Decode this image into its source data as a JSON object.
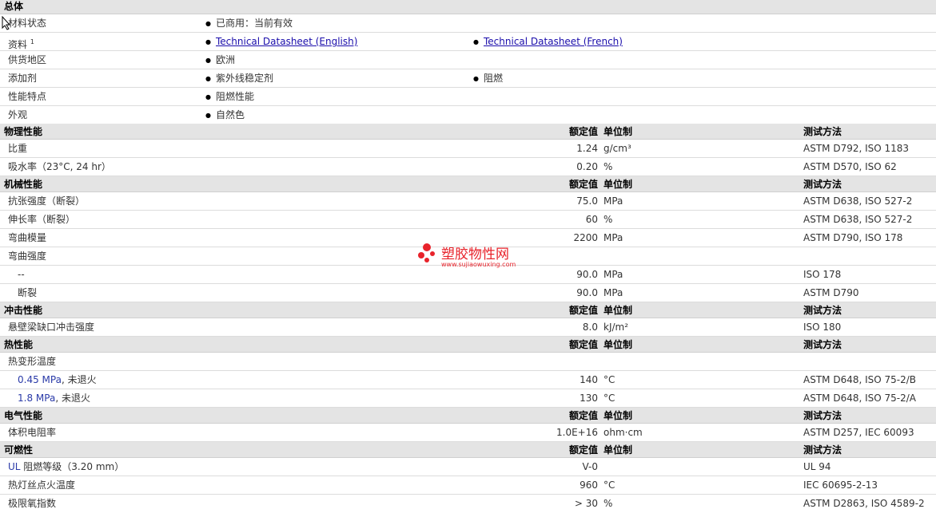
{
  "general": {
    "title": "总体",
    "rows": [
      {
        "label": "材料状态",
        "items": [
          "已商用：当前有效"
        ]
      },
      {
        "label": "资料",
        "sup": "1",
        "items": [
          "Technical Datasheet (English)",
          "Technical Datasheet (French)"
        ]
      },
      {
        "label": "供货地区",
        "items": [
          "欧洲"
        ]
      },
      {
        "label": "添加剂",
        "items": [
          "紫外线稳定剂",
          "阻燃"
        ]
      },
      {
        "label": "性能特点",
        "items": [
          "阻燃性能"
        ]
      },
      {
        "label": "外观",
        "items": [
          "自然色"
        ]
      }
    ]
  },
  "headers": {
    "value": "额定值",
    "unit": "单位制",
    "method": "测试方法"
  },
  "sections": [
    {
      "title": "物理性能",
      "rows": [
        {
          "label": "比重",
          "value": "1.24",
          "unit": "g/cm³",
          "method": "ASTM D792, ISO 1183"
        },
        {
          "label": "吸水率（23°C, 24 hr）",
          "value": "0.20",
          "unit": "%",
          "method": "ASTM D570, ISO 62"
        }
      ]
    },
    {
      "title": "机械性能",
      "rows": [
        {
          "label": "抗张强度（断裂）",
          "value": "75.0",
          "unit": "MPa",
          "method": "ASTM D638, ISO 527-2"
        },
        {
          "label": "伸长率（断裂）",
          "value": "60",
          "unit": "%",
          "method": "ASTM D638, ISO 527-2"
        },
        {
          "label": "弯曲模量",
          "value": "2200",
          "unit": "MPa",
          "method": "ASTM D790, ISO 178"
        },
        {
          "label": "弯曲强度",
          "value": "",
          "unit": "",
          "method": ""
        },
        {
          "label": "--",
          "value": "90.0",
          "unit": "MPa",
          "method": "ISO 178"
        },
        {
          "label": "断裂",
          "value": "90.0",
          "unit": "MPa",
          "method": "ASTM D790"
        }
      ]
    },
    {
      "title": "冲击性能",
      "rows": [
        {
          "label": "悬壁梁缺口冲击强度",
          "value": "8.0",
          "unit": "kJ/m²",
          "method": "ISO 180"
        }
      ]
    },
    {
      "title": "热性能",
      "rows": [
        {
          "label": "热变形温度",
          "value": "",
          "unit": "",
          "method": ""
        },
        {
          "label_blue": "0.45 MPa",
          "label_rest": ", 未退火",
          "value": "140",
          "unit": "°C",
          "method": "ASTM D648, ISO 75-2/B"
        },
        {
          "label_blue": "1.8 MPa",
          "label_rest": ", 未退火",
          "value": "130",
          "unit": "°C",
          "method": "ASTM D648, ISO 75-2/A"
        }
      ]
    },
    {
      "title": "电气性能",
      "rows": [
        {
          "label": "体积电阻率",
          "value": "1.0E+16",
          "unit": "ohm·cm",
          "method": "ASTM D257, IEC 60093"
        }
      ]
    },
    {
      "title": "可燃性",
      "rows": [
        {
          "label_blue": "UL",
          "label_rest": " 阻燃等级（3.20 mm）",
          "value": "V-0",
          "unit": "",
          "method": "UL 94"
        },
        {
          "label": "热灯丝点火温度",
          "value": "960",
          "unit": "°C",
          "method": "IEC 60695-2-13"
        },
        {
          "label": "极限氧指数",
          "value": "> 30",
          "unit": "%",
          "method": "ASTM D2863, ISO 4589-2"
        }
      ]
    }
  ],
  "watermark": {
    "name": "塑胶物性网",
    "url": "www.sujiaowuxing.com",
    "color": "#e8232b"
  }
}
